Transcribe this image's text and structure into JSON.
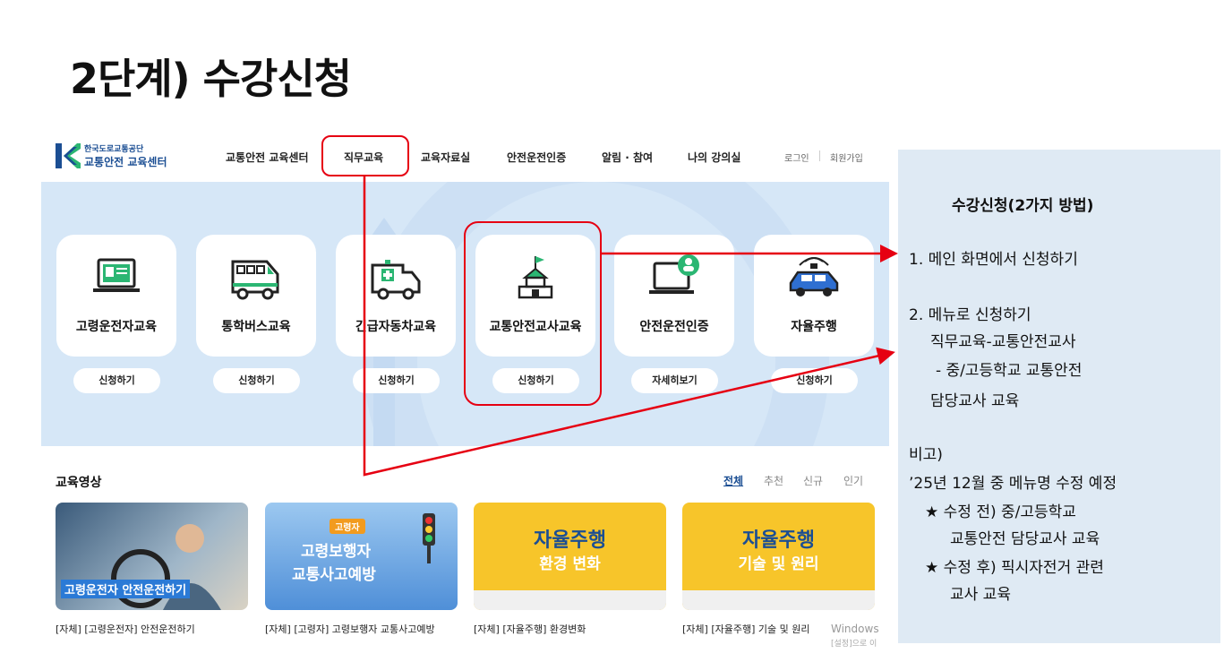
{
  "slide": {
    "title": "2단계) 수강신청"
  },
  "logo": {
    "line1": "한국도로교통공단",
    "line2": "교통안전 교육센터"
  },
  "nav": [
    "교통안전 교육센터",
    "직무교육",
    "교육자료실",
    "안전운전인증",
    "알림 · 참여",
    "나의 강의실"
  ],
  "util": {
    "login": "로그인",
    "signup": "회원가입"
  },
  "cards": [
    {
      "label": "고령운전자교육",
      "button": "신청하기",
      "icon": "monitor-id-icon"
    },
    {
      "label": "통학버스교육",
      "button": "신청하기",
      "icon": "bus-icon"
    },
    {
      "label": "긴급자동차교육",
      "button": "신청하기",
      "icon": "ambulance-icon"
    },
    {
      "label": "교통안전교사교육",
      "button": "신청하기",
      "icon": "school-icon"
    },
    {
      "label": "안전운전인증",
      "button": "자세히보기",
      "icon": "laptop-user-icon"
    },
    {
      "label": "자율주행",
      "button": "신청하기",
      "icon": "autonomous-car-icon"
    }
  ],
  "videos": {
    "title": "교육영상",
    "filters": [
      "전체",
      "추천",
      "신규",
      "인기"
    ],
    "items": [
      {
        "caption": "[자체] [고령운전자] 안전운전하기",
        "overlay": "고령운전자 안전운전하기"
      },
      {
        "caption": "[자체] [고령자] 고령보행자 교통사고예방",
        "badge": "고령자",
        "overlay_1": "고령보행자",
        "overlay_2": "교통사고예방"
      },
      {
        "caption": "[자체] [자율주행] 환경변화",
        "overlay_1": "자율주행",
        "overlay_2": "환경 변화"
      },
      {
        "caption": "[자체] [자율주행] 기술 및 원리",
        "overlay_1": "자율주행",
        "overlay_2": "기술 및 원리"
      }
    ]
  },
  "watermark": {
    "line1": "Windows",
    "line2": "[설정]으로 이"
  },
  "panel": {
    "title": "수강신청(2가지 방법)",
    "item1": "1. 메인 화면에서 신청하기",
    "item2": "2. 메뉴로 신청하기",
    "item2_sub1": "직무교육-교통안전교사",
    "item2_sub2": "- 중/고등학교 교통안전",
    "item2_sub3": "담당교사 교육",
    "note_title": "비고)",
    "note_line": "’25년 12월 중 메뉴명 수정 예정",
    "before_1": "★ 수정 전) 중/고등학교",
    "before_2": "교통안전 담당교사 교육",
    "after_1": "★ 수정 후) 픽시자전거 관련",
    "after_2": "교사 교육"
  },
  "colors": {
    "highlight": "#e60012",
    "panel_bg": "#dfeaf4",
    "hero_bg": "#d6e7f7",
    "brand": "#1b4e93"
  }
}
